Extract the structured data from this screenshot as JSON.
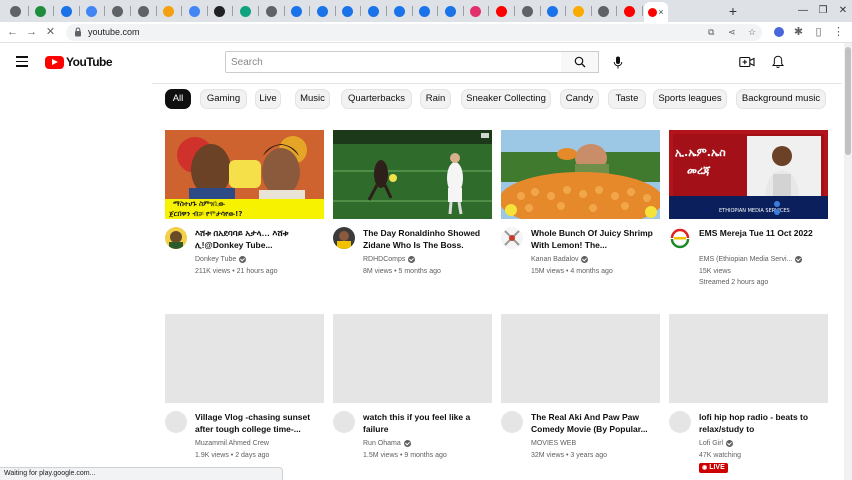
{
  "browser": {
    "tabs": [
      {
        "favicon": "chrome-icon",
        "color": "#5f6368"
      },
      {
        "favicon": "spreadsheet-icon",
        "color": "#1e8e3e"
      },
      {
        "favicon": "website-icon",
        "color": "#1a73e8"
      },
      {
        "favicon": "website-icon",
        "color": "#4285f4"
      },
      {
        "favicon": "globe-icon",
        "color": "#5f6368"
      },
      {
        "favicon": "globe-icon",
        "color": "#5f6368"
      },
      {
        "favicon": "orange-app-icon",
        "color": "#f4a011"
      },
      {
        "favicon": "google-icon",
        "color": "#4285f4"
      },
      {
        "favicon": "black-app-icon",
        "color": "#202124"
      },
      {
        "favicon": "chatgpt-icon",
        "color": "#10a37f"
      },
      {
        "favicon": "globe-icon",
        "color": "#5f6368"
      },
      {
        "favicon": "website-icon",
        "color": "#1a73e8"
      },
      {
        "favicon": "website-icon",
        "color": "#1a73e8"
      },
      {
        "favicon": "website-icon",
        "color": "#1a73e8"
      },
      {
        "favicon": "website-icon",
        "color": "#1a73e8"
      },
      {
        "favicon": "website-icon",
        "color": "#1a73e8"
      },
      {
        "favicon": "website-icon",
        "color": "#1a73e8"
      },
      {
        "favicon": "website-icon",
        "color": "#1a73e8"
      },
      {
        "favicon": "instagram-icon",
        "color": "#e1306c"
      },
      {
        "favicon": "youtube-icon",
        "color": "#ff0000"
      },
      {
        "favicon": "globe-icon",
        "color": "#5f6368"
      },
      {
        "favicon": "website-icon",
        "color": "#1a73e8"
      },
      {
        "favicon": "emoji-icon",
        "color": "#f9ab00"
      },
      {
        "favicon": "globe-icon",
        "color": "#5f6368"
      },
      {
        "favicon": "youtube-icon",
        "color": "#ff0000"
      }
    ],
    "active_tab": {
      "favicon": "youtube-icon",
      "close": "×"
    },
    "new_tab": "+",
    "url": "youtube.com",
    "status": "Waiting for play.google.com..."
  },
  "youtube": {
    "logo_text": "YouTube",
    "search_placeholder": "Search",
    "chips": [
      "All",
      "Gaming",
      "Live",
      "Music",
      "Quarterbacks",
      "Rain",
      "Sneaker Collecting",
      "Candy",
      "Taste",
      "Sports leagues",
      "Background music"
    ],
    "videos": [
      {
        "title": "እሸቱ በአደባባይ አታላ… እሸቱ ሊ!@Donkey Tube...",
        "channel": "Donkey Tube",
        "verified": true,
        "meta": "211K views • 21 hours ago"
      },
      {
        "title": "The Day Ronaldinho Showed Zidane Who Is The Boss.",
        "channel": "RDHDComps",
        "verified": true,
        "meta": "8M views • 5 months ago"
      },
      {
        "title": "Whole Bunch Of Juicy Shrimp With Lemon! The...",
        "channel": "Kanan Badalov",
        "verified": true,
        "meta": "15M views • 4 months ago"
      },
      {
        "title": "EMS Mereja Tue 11 Oct 2022",
        "channel": "EMS (Ethiopian Media Servi...",
        "verified": true,
        "meta": "15K views",
        "meta2": "Streamed 2 hours ago"
      },
      {
        "title": "Village Vlog -chasing sunset after tough college time-...",
        "channel": "Muzammil Ahmed Crew",
        "verified": false,
        "meta": "1.9K views • 2 days ago"
      },
      {
        "title": "watch this if you feel like a failure",
        "channel": "Run Ohama",
        "verified": true,
        "meta": "1.5M views • 9 months ago"
      },
      {
        "title": "The Real Aki And Paw Paw Comedy Movie (By Popular...",
        "channel": "MOVIES WEB",
        "verified": false,
        "meta": "32M views • 3 years ago"
      },
      {
        "title": "lofi hip hop radio - beats to relax/study to",
        "channel": "Lofi Girl",
        "verified": true,
        "meta": "47K watching",
        "badge": "LIVE"
      }
    ],
    "thumb4_text": {
      "line1": "ኢ.ኤም.ኤስ",
      "line2": "መረጃ"
    }
  }
}
